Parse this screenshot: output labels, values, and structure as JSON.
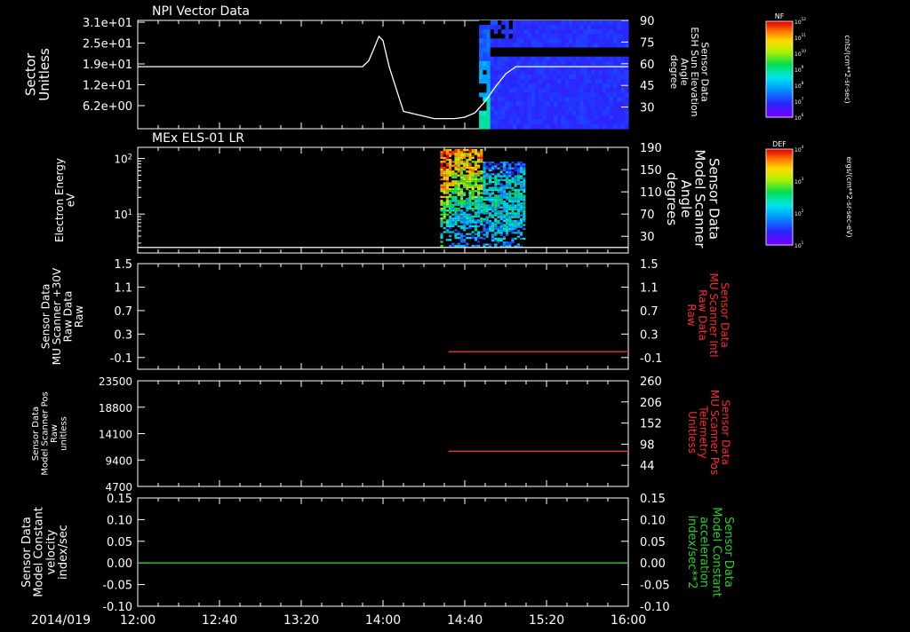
{
  "colors": {
    "white": "#ffffff",
    "red": "#ff2a2a",
    "green": "#22d22a",
    "background": "#000000"
  },
  "time_axis": {
    "date_label": "2014/019",
    "ticks": [
      "12:00",
      "12:40",
      "13:20",
      "14:00",
      "14:40",
      "15:20",
      "16:00"
    ],
    "range": [
      "12:00",
      "16:00"
    ]
  },
  "colorbars": [
    {
      "title": "NF",
      "unit": "cnts/(cm**2-sr-sec)",
      "tick_labels": [
        "10^12",
        "10^11",
        "10^10",
        "10^9",
        "10^8",
        "10^7",
        "10^6"
      ],
      "log_range": [
        6,
        12
      ]
    },
    {
      "title": "DEF",
      "unit": "ergs/(cm**2-sr-sec-eV)",
      "tick_labels": [
        "10^4",
        "10^3",
        "10^2",
        "10^1"
      ],
      "log_range": [
        1,
        4
      ]
    }
  ],
  "chart_data": [
    {
      "type": "heatmap",
      "title": "NPI Vector Data",
      "ylabel": [
        "Sector",
        "Unitless"
      ],
      "y_ticks": [
        "3.1e+01",
        "2.5e+01",
        "1.9e+01",
        "1.2e+01",
        "6.2e+00"
      ],
      "y_right_label": [
        "Sensor Data",
        "ESH Sun Elevation",
        "Angle",
        "degree"
      ],
      "y_right_ticks": [
        "90",
        "75",
        "60",
        "45",
        "30"
      ],
      "y_right_range": [
        15,
        90
      ],
      "heatmap_time_range": [
        "14:47",
        "16:00"
      ],
      "line_series": {
        "axis": "right",
        "x": [
          "12:00",
          "13:50",
          "13:53",
          "13:56",
          "13:58",
          "14:00",
          "14:03",
          "14:10",
          "14:25",
          "14:35",
          "14:40",
          "14:45",
          "14:50",
          "14:55",
          "15:00",
          "15:05",
          "16:00"
        ],
        "y": [
          58,
          58,
          62,
          72,
          79,
          76,
          58,
          27,
          22,
          22,
          23,
          26,
          34,
          44,
          53,
          58,
          58
        ]
      }
    },
    {
      "type": "heatmap",
      "title": "MEx ELS-01 LR",
      "ylabel": [
        "Electron Energy",
        "eV"
      ],
      "y_ticks": [
        "10^2",
        "10^1"
      ],
      "y_log_range": [
        0.3,
        2.2
      ],
      "y_right_label": [
        "Sensor Data",
        "Model Scanner",
        "Angle",
        "degrees"
      ],
      "y_right_ticks": [
        "190",
        "150",
        "110",
        "70",
        "30"
      ],
      "y_right_range": [
        0,
        190
      ],
      "heatmap_time_range": [
        "14:28",
        "15:09"
      ],
      "line_series": {
        "axis": "right",
        "x": [
          "12:00",
          "16:00"
        ],
        "y": [
          10,
          10
        ]
      }
    },
    {
      "type": "line",
      "ylabel": [
        "Sensor Data",
        "MU Scanner +30V",
        "Raw Data",
        "Raw"
      ],
      "y_ticks": [
        "1.5",
        "1.1",
        "0.7",
        "0.3",
        "-0.1"
      ],
      "y_range": [
        -0.3,
        1.5
      ],
      "y_right_label": [
        "Sensor Data",
        "MU Scanner Intl",
        "Raw Data",
        "Raw"
      ],
      "y_right_ticks": [
        "1.5",
        "1.1",
        "0.7",
        "0.3",
        "-0.1"
      ],
      "series": [
        {
          "axis": "right",
          "color": "red",
          "x": [
            "14:32",
            "16:00"
          ],
          "y": [
            0.0,
            0.0
          ]
        }
      ]
    },
    {
      "type": "line",
      "ylabel": [
        "Sensor Data",
        "Model Scanner Pos",
        "Raw",
        "unitless"
      ],
      "y_ticks": [
        "23500",
        "18800",
        "14100",
        "9400",
        "4700"
      ],
      "y_range": [
        0,
        23500
      ],
      "y_right_label": [
        "Sensor Data",
        "MU Scanner Pos",
        "Telemetry",
        "Unitless"
      ],
      "y_right_ticks": [
        "260",
        "206",
        "152",
        "98",
        "44"
      ],
      "y_right_range": [
        -10,
        260
      ],
      "series": [
        {
          "axis": "right",
          "color": "red",
          "x": [
            "14:32",
            "16:00"
          ],
          "y": [
            80,
            80
          ]
        }
      ]
    },
    {
      "type": "line",
      "ylabel": [
        "Sensor Data",
        "Model Constant",
        "velocity",
        "index/sec"
      ],
      "y_ticks": [
        "0.15",
        "0.10",
        "0.05",
        "0.00",
        "-0.05",
        "-0.10"
      ],
      "y_range": [
        -0.1,
        0.15
      ],
      "y_right_label": [
        "Sensor Data",
        "Model Constant",
        "acceleration",
        "index/sec**2"
      ],
      "y_right_ticks": [
        "0.15",
        "0.10",
        "0.05",
        "0.00",
        "-0.05",
        "-0.10"
      ],
      "series": [
        {
          "axis": "left",
          "color": "green",
          "x": [
            "12:00",
            "16:00"
          ],
          "y": [
            0.0,
            0.0
          ]
        }
      ]
    }
  ]
}
